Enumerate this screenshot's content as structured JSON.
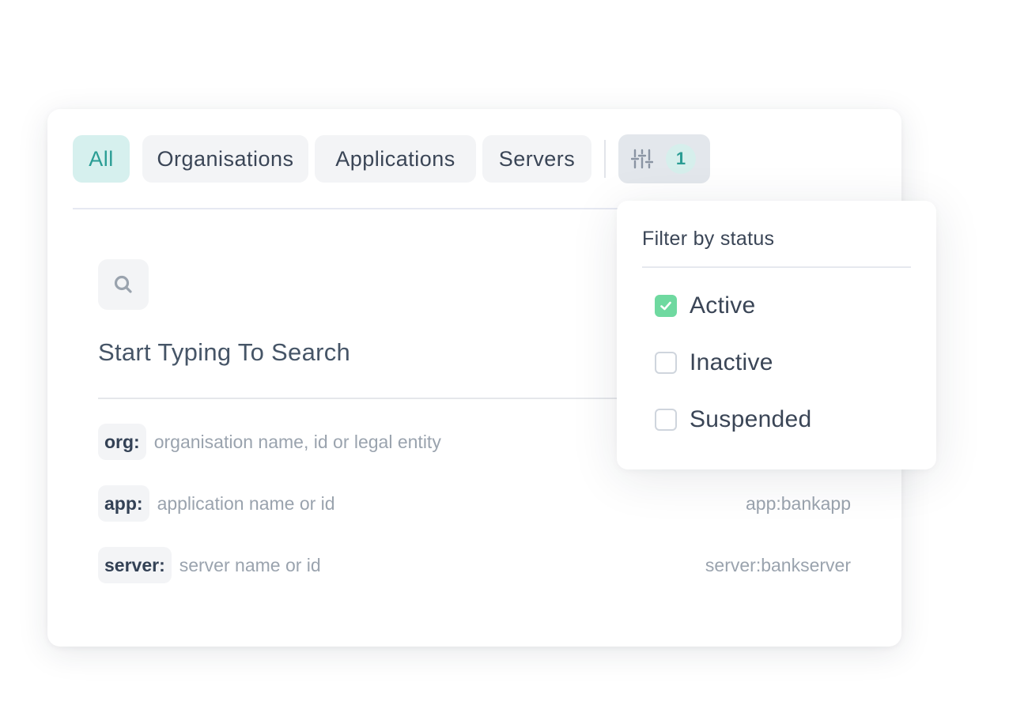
{
  "tabs": {
    "all": "All",
    "organisations": "Organisations",
    "applications": "Applications",
    "servers": "Servers"
  },
  "filter_button": {
    "icon": "sliders-icon",
    "count": "1"
  },
  "search": {
    "icon": "search-icon",
    "title": "Start Typing To Search"
  },
  "hints": [
    {
      "key": "org:",
      "description": "organisation name, id or legal entity",
      "example": ""
    },
    {
      "key": "app:",
      "description": "application name or id",
      "example": "app:bankapp"
    },
    {
      "key": "server:",
      "description": "server name or id",
      "example": "server:bankserver"
    }
  ],
  "status_filter": {
    "title": "Filter by status",
    "options": [
      {
        "label": "Active",
        "checked": true
      },
      {
        "label": "Inactive",
        "checked": false
      },
      {
        "label": "Suspended",
        "checked": false
      }
    ]
  },
  "colors": {
    "accent": "#2a9d94",
    "accent_bg": "#d6f0ee",
    "checkbox_checked": "#6fd9a0"
  }
}
